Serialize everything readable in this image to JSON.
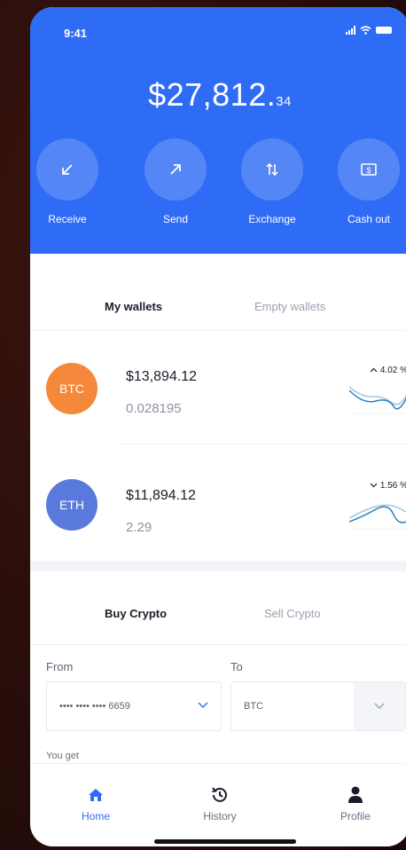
{
  "status": {
    "time": "9:41"
  },
  "balance": {
    "main": "$27,812.",
    "cents": "34"
  },
  "actions": [
    {
      "label": "Receive",
      "icon": "arrow-down-left-icon"
    },
    {
      "label": "Send",
      "icon": "arrow-up-right-icon"
    },
    {
      "label": "Exchange",
      "icon": "swap-icon"
    },
    {
      "label": "Cash out",
      "icon": "cash-icon"
    }
  ],
  "wallet_tabs": {
    "active": "My wallets",
    "inactive": "Empty wallets"
  },
  "wallets": [
    {
      "symbol": "BTC",
      "usd": "$13,894.12",
      "amount": "0.028195",
      "change": "4.02 %",
      "color": "#f5883a"
    },
    {
      "symbol": "ETH",
      "usd": "$11,894.12",
      "amount": "2.29",
      "change": "1.56 %",
      "color": "#5a79dd"
    }
  ],
  "trade_tabs": {
    "active": "Buy Crypto",
    "inactive": "Sell Crypto"
  },
  "form": {
    "from_label": "From",
    "to_label": "To",
    "from_value": "•••• •••• •••• 6659",
    "to_value": "BTC",
    "you_get": "You get"
  },
  "tabbar": [
    {
      "label": "Home",
      "icon": "home-icon",
      "active": true
    },
    {
      "label": "History",
      "icon": "history-icon",
      "active": false
    },
    {
      "label": "Profile",
      "icon": "profile-icon",
      "active": false
    }
  ],
  "colors": {
    "primary": "#2f6cf5",
    "btc": "#f5883a",
    "eth": "#5a79dd"
  }
}
